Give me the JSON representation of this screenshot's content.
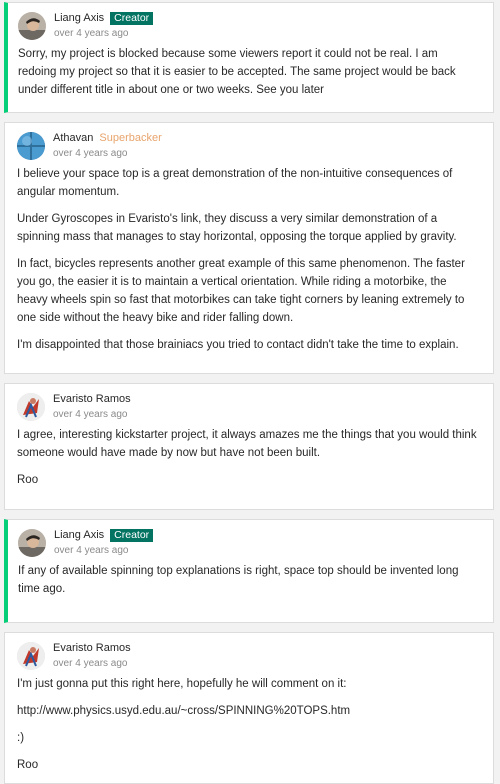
{
  "comments": [
    {
      "author": "Liang Axis",
      "badge": "Creator",
      "time": "over 4 years ago",
      "paragraphs": [
        "Sorry, my project is blocked because some viewers report it could not be real. I am redoing my project so that it is easier to be accepted. The same project would be back under different title in about one or two weeks. See you later"
      ]
    },
    {
      "author": "Athavan",
      "badge": "Superbacker",
      "time": "over 4 years ago",
      "paragraphs": [
        "I believe your space top is a great demonstration of the non-intuitive consequences of angular momentum.",
        "Under Gyroscopes in Evaristo's link, they discuss a very similar demonstration of a spinning mass that manages to stay horizontal, opposing the torque applied by gravity.",
        "In fact, bicycles represents another great example of this same phenomenon. The faster you go, the easier it is to maintain a vertical orientation. While riding a motorbike, the heavy wheels spin so fast that motorbikes can take tight corners by leaning extremely to one side without the heavy bike and rider falling down.",
        "I'm disappointed that those brainiacs you tried to contact didn't take the time to explain."
      ]
    },
    {
      "author": "Evaristo Ramos",
      "time": "over 4 years ago",
      "paragraphs": [
        "I agree, interesting kickstarter project, it always amazes me the things that you would think someone would have made by now but have not been built.",
        "Roo"
      ]
    },
    {
      "author": "Liang Axis",
      "badge": "Creator",
      "time": "over 4 years ago",
      "paragraphs": [
        "If any of available spinning top explanations is right, space top should be invented long time ago."
      ]
    },
    {
      "author": "Evaristo Ramos",
      "time": "over 4 years ago",
      "paragraphs": [
        "I'm just gonna put this right here, hopefully he will comment on it:",
        "http://www.physics.usyd.edu.au/~cross/SPINNING%20TOPS.htm",
        ":)",
        "Roo"
      ]
    }
  ],
  "colors": {
    "creator_border": "#05ce78",
    "creator_badge": "#037362",
    "superbacker": "#e8a46c"
  }
}
